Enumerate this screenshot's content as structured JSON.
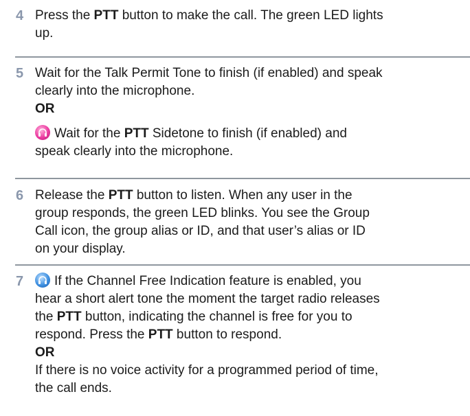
{
  "steps": [
    {
      "number": "4",
      "lines": [
        {
          "parts": [
            "Press the ",
            "PTT",
            " button to make the call. The green LED lights"
          ]
        },
        {
          "text": "up."
        }
      ]
    },
    {
      "number": "5",
      "line1": "Wait for the Talk Permit Tone to finish (if enabled) and speak",
      "line2": "clearly into the microphone.",
      "or": "OR",
      "alt_pre": "Wait for the ",
      "alt_bold": "PTT",
      "alt_post": " Sidetone to finish (if enabled) and",
      "alt_line2": "speak clearly into the microphone."
    },
    {
      "number": "6",
      "l1_pre": "Release the ",
      "l1_bold": "PTT",
      "l1_post": " button to listen. When any user in the",
      "line2": "group responds, the green LED blinks. You see the Group",
      "line3": "Call icon, the group alias or ID, and that user’s alias or ID",
      "line4": "on your display."
    },
    {
      "number": "7",
      "l1": "If the Channel Free Indication feature is enabled, you",
      "l2": "hear a short alert tone the moment the target radio releases",
      "l3_pre": "the ",
      "l3_bold": "PTT",
      "l3_post": " button, indicating the channel is free for you to",
      "l4_pre": "respond. Press the ",
      "l4_bold": "PTT",
      "l4_post": " button to respond.",
      "or": "OR",
      "l5": "If there is no voice activity for a programmed period of time,",
      "l6": "the call ends."
    }
  ],
  "icons": {
    "sidetone": "sidetone-icon",
    "channel_free": "channel-free-icon"
  },
  "colors": {
    "step_number": "#8a97ac",
    "rule": "#8e969e",
    "text": "#1b1b1b"
  }
}
